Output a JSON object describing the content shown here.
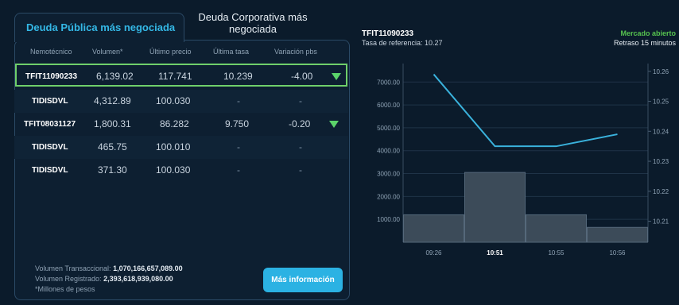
{
  "tabs": {
    "active": "Deuda Pública más negociada",
    "inactive": "Deuda Corporativa más negociada"
  },
  "table": {
    "columns": [
      "Nemotécnico",
      "Volumen*",
      "Último precio",
      "Última tasa",
      "Variación pbs"
    ],
    "rows": [
      {
        "ticker": "TFIT11090233",
        "volume": "6,139.02",
        "price": "117.741",
        "rate": "10.239",
        "variation": "-4.00",
        "trend": "down",
        "selected": true
      },
      {
        "ticker": "TIDISDVL",
        "volume": "4,312.89",
        "price": "100.030",
        "rate": "-",
        "variation": "-",
        "trend": ""
      },
      {
        "ticker": "TFIT08031127",
        "volume": "1,800.31",
        "price": "86.282",
        "rate": "9.750",
        "variation": "-0.20",
        "trend": "down"
      },
      {
        "ticker": "TIDISDVL",
        "volume": "465.75",
        "price": "100.010",
        "rate": "-",
        "variation": "-",
        "trend": ""
      },
      {
        "ticker": "TIDISDVL",
        "volume": "371.30",
        "price": "100.030",
        "rate": "-",
        "variation": "-",
        "trend": ""
      }
    ]
  },
  "footer": {
    "transactional_label": "Volumen Transaccional: ",
    "transactional_value": "1,070,166,657,089.00",
    "registered_label": "Volumen Registrado: ",
    "registered_value": "2,393,618,939,080.00",
    "note": "*Millones de pesos",
    "more_button": "Más información"
  },
  "chart_header": {
    "ticker": "TFIT11090233",
    "reference": "Tasa de referencia: 10.27",
    "market_status": "Mercado abierto",
    "delay": "Retraso 15 minutos"
  },
  "colors": {
    "accent": "#34b8e6",
    "selected_border": "#6fcf6a",
    "market_open": "#56c24f",
    "line": "#3ab2dc",
    "bars": "#3c4b59"
  },
  "chart_data": {
    "type": "bar+line",
    "categories": [
      "09:26",
      "10:51",
      "10:55",
      "10:56"
    ],
    "bold_category": "10:51",
    "series": [
      {
        "axis": "left",
        "type": "bar",
        "values": [
          1200,
          3050,
          1200,
          650
        ]
      },
      {
        "axis": "right",
        "type": "line",
        "values": [
          10.259,
          10.235,
          10.235,
          10.239
        ]
      }
    ],
    "y_left": {
      "ticks": [
        1000,
        2000,
        3000,
        4000,
        5000,
        6000,
        7000
      ],
      "labels": [
        "1000.00",
        "2000.00",
        "3000.00",
        "4000.00",
        "5000.00",
        "6000.00",
        "7000.00"
      ],
      "range": [
        0,
        7600
      ]
    },
    "y_right": {
      "ticks": [
        10.21,
        10.22,
        10.23,
        10.24,
        10.25,
        10.26
      ],
      "range": [
        10.203,
        10.261
      ]
    },
    "grid": true
  }
}
